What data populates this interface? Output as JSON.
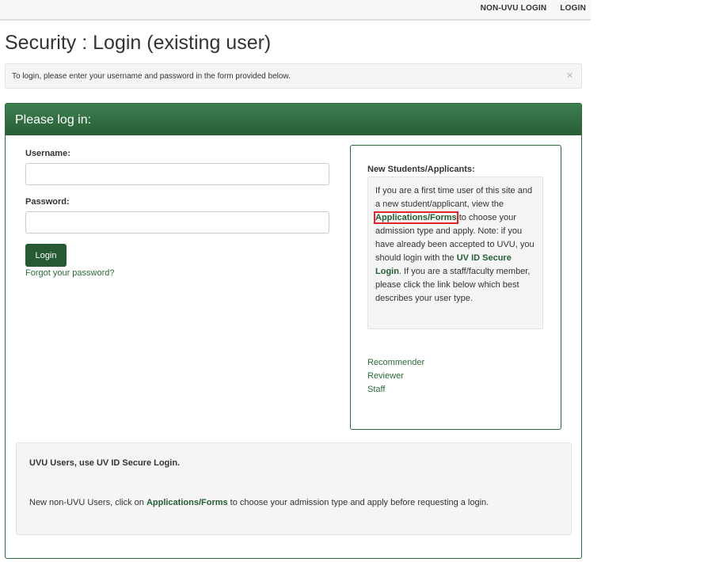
{
  "topnav": {
    "non_uvu_login": "NON-UVU LOGIN",
    "login": "LOGIN"
  },
  "page": {
    "title": "Security : Login (existing user)"
  },
  "alert": {
    "text": "To login, please enter your username and password in the form provided below.",
    "close_glyph": "×"
  },
  "panel": {
    "heading": "Please log in:"
  },
  "form": {
    "username_label": "Username:",
    "username_value": "",
    "password_label": "Password:",
    "password_value": "",
    "login_button": "Login",
    "forgot_link": "Forgot your password?"
  },
  "info": {
    "title": "New Students/Applicants:",
    "text_1": "If you are a first time user of this site and a new student/applicant, view the ",
    "link_forms": "Applications/Forms",
    "text_2": " to choose your admission type and apply. Note: if you have already been accepted to UVU, you should login with the ",
    "uvid_link": "UV ID Secure Login",
    "text_3": ". If you are a staff/faculty member, please click the link below which best describes your user type.",
    "roles": [
      "Recommender",
      "Reviewer",
      "Staff"
    ]
  },
  "bottom": {
    "title": "UVU Users, use UV ID Secure Login.",
    "text_before": "New non-UVU Users, click on ",
    "link": "Applications/Forms",
    "text_after": " to choose your admission type and apply before requesting a login."
  },
  "colors": {
    "brand_green": "#285e35",
    "link_green": "#2a6b3a",
    "highlight_red": "#e0262a"
  }
}
